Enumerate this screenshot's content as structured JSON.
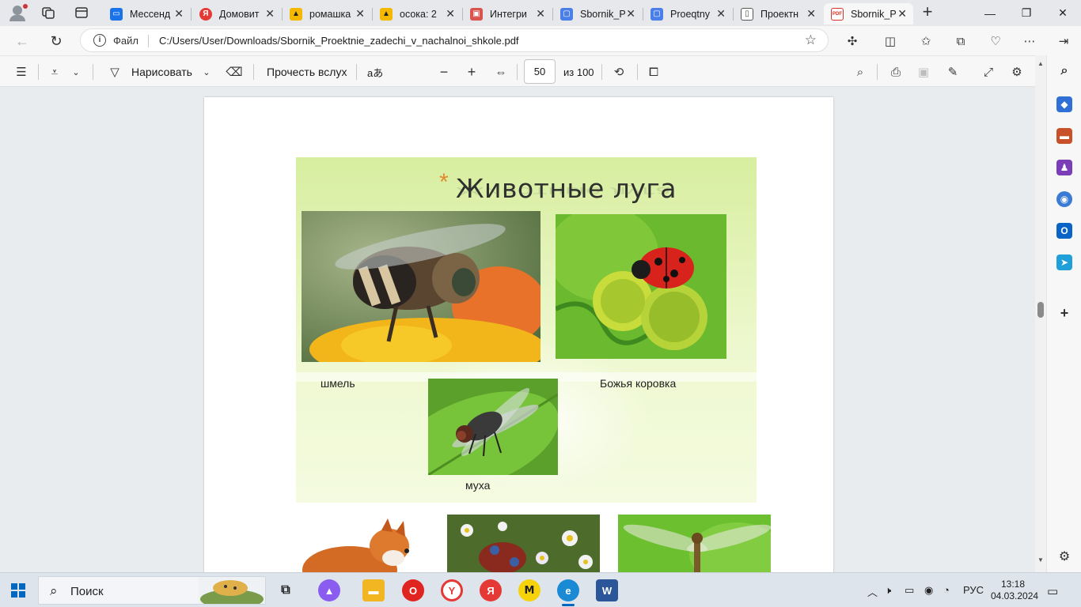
{
  "browser": {
    "tabs": [
      {
        "title": "Мессенд",
        "favicon_color": "#1a73e8",
        "glyph": "▭"
      },
      {
        "title": "Домовит",
        "favicon_color": "#e53935",
        "glyph": "Я"
      },
      {
        "title": "ромашка",
        "favicon_color": "#f5b800",
        "glyph": "▲"
      },
      {
        "title": "осока: 2",
        "favicon_color": "#f5b800",
        "glyph": "▲"
      },
      {
        "title": "Интегри",
        "favicon_color": "#d9534f",
        "glyph": "▣"
      },
      {
        "title": "Sbornik_P",
        "favicon_color": "#4a7ee8",
        "glyph": "▢"
      },
      {
        "title": "Proeqtny",
        "favicon_color": "#4a7ee8",
        "glyph": "▢"
      },
      {
        "title": "Проектн",
        "favicon_color": "#ffffff",
        "glyph": "▯"
      },
      {
        "title": "Sbornik_P",
        "favicon_color": "#d93025",
        "glyph": "PDF",
        "active": true
      }
    ],
    "address": {
      "scheme_label": "Файл",
      "url": "C:/Users/User/Downloads/Sbornik_Proektnie_zadechi_v_nachalnoi_shkole.pdf"
    }
  },
  "pdf_toolbar": {
    "draw_label": "Нарисовать",
    "read_aloud_label": "Прочесть вслух",
    "translate_glyph": "aあ",
    "page_current": "50",
    "page_total_label": "из 100"
  },
  "document": {
    "slide_title": "Животные луга",
    "captions": {
      "bumblebee": "шмель",
      "ladybug": "Божья коровка",
      "fly": "муха"
    }
  },
  "taskbar": {
    "search_label": "Поиск",
    "language": "РУС",
    "time": "13:18",
    "date": "04.03.2024"
  },
  "colors": {
    "accent": "#0067c0",
    "slide_green": "#d7ee9f",
    "title_star": "#e0892e"
  }
}
